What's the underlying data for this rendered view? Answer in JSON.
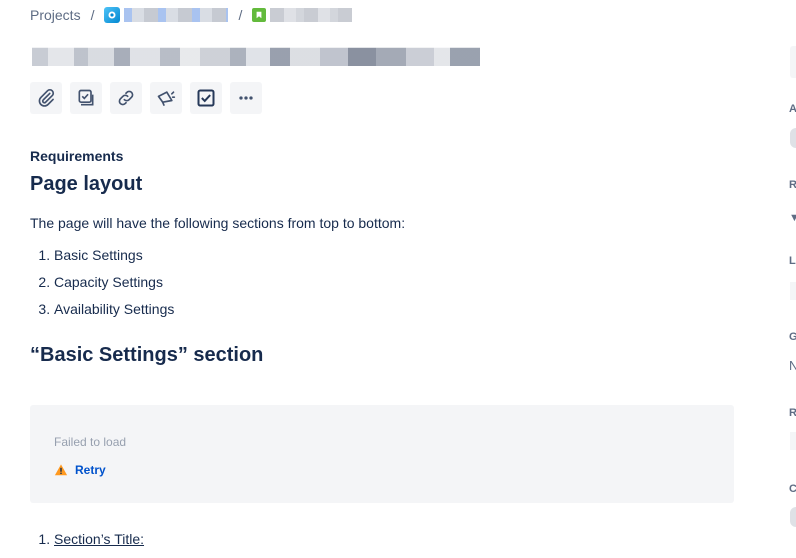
{
  "breadcrumb": {
    "projects_label": "Projects",
    "separator": "/"
  },
  "toolbar": {
    "buttons": [
      "attachment-icon",
      "add-child-icon",
      "link-icon",
      "megaphone-icon",
      "checkbox-icon",
      "more-icon"
    ]
  },
  "description": {
    "field_label": "Requirements",
    "heading_layout": "Page layout",
    "intro": "The page will have the following sections from top to bottom:",
    "sections": [
      "Basic Settings",
      "Capacity Settings",
      "Availability Settings"
    ],
    "heading_basic": "“Basic Settings” section",
    "failed_text": "Failed to load",
    "retry_label": "Retry",
    "sub_items": [
      "Section’s Title:"
    ]
  },
  "sidebar": {
    "letters": [
      "A",
      "R",
      "L",
      "G",
      "R",
      "C"
    ],
    "values": [
      "N"
    ]
  },
  "colors": {
    "link": "#0052cc",
    "text": "#172b4d",
    "muted": "#5e6c84",
    "warning": "#ff991f",
    "story": "#63ba3c"
  }
}
